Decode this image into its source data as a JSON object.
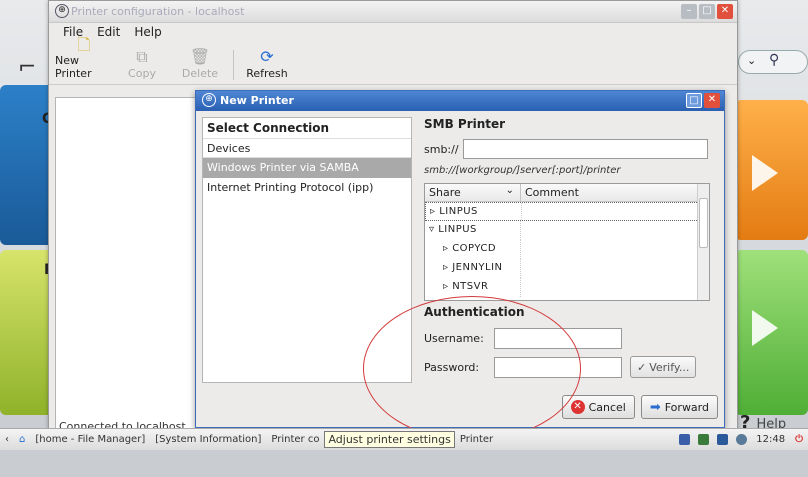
{
  "main_window": {
    "title": "Printer configuration - localhost",
    "menu": [
      "File",
      "Edit",
      "Help"
    ],
    "toolbar": {
      "new_printer": "New Printer",
      "copy": "Copy",
      "delete": "Delete",
      "refresh": "Refresh"
    },
    "status": "Connected to localhost"
  },
  "dialog": {
    "title": "New Printer",
    "select_connection_header": "Select Connection",
    "connections": [
      "Devices",
      "Windows Printer via SAMBA",
      "Internet Printing Protocol (ipp)"
    ],
    "selected_connection_index": 1,
    "smb_heading": "SMB Printer",
    "smb_prefix": "smb://",
    "smb_value": "",
    "smb_hint": "smb://[workgroup/]server[:port]/printer",
    "share_columns": [
      "Share",
      "Comment"
    ],
    "shares": [
      {
        "name": "LINPUS",
        "expander": "right",
        "indent": 0
      },
      {
        "name": "LINPUS",
        "expander": "down",
        "indent": 0
      },
      {
        "name": "COPYCD",
        "expander": "right",
        "indent": 1
      },
      {
        "name": "JENNYLIN",
        "expander": "right",
        "indent": 1
      },
      {
        "name": "NTSVR",
        "expander": "right",
        "indent": 1
      }
    ],
    "auth_heading": "Authentication",
    "username_label": "Username:",
    "password_label": "Password:",
    "username_value": "",
    "password_value": "",
    "verify_label": "Verify...",
    "cancel_label": "Cancel",
    "forward_label": "Forward"
  },
  "desktop": {
    "help_label": "Help"
  },
  "taskbar": {
    "items": [
      "[home - File Manager]",
      "[System Information]",
      "Printer co"
    ],
    "tooltip": "Adjust printer settings",
    "tooltip_trail": "Printer",
    "clock": "12:48"
  }
}
